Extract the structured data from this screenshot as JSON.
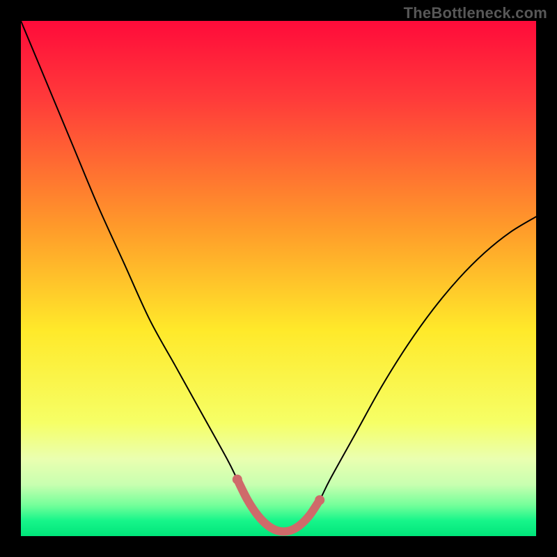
{
  "watermark": "TheBottleneck.com",
  "chart_data": {
    "type": "line",
    "title": "",
    "xlabel": "",
    "ylabel": "",
    "xlim": [
      0,
      100
    ],
    "ylim": [
      0,
      100
    ],
    "x": [
      0,
      5,
      10,
      15,
      20,
      25,
      30,
      35,
      40,
      42,
      44,
      46,
      48,
      50,
      52,
      54,
      56,
      58,
      60,
      65,
      70,
      75,
      80,
      85,
      90,
      95,
      100
    ],
    "y": [
      100,
      88,
      76,
      64,
      53,
      42,
      33,
      24,
      15,
      11,
      7,
      4,
      2,
      1,
      1,
      2,
      4,
      7,
      11,
      20,
      29,
      37,
      44,
      50,
      55,
      59,
      62
    ],
    "series": [
      {
        "name": "bottleneck-curve",
        "stroke": "#000000",
        "stroke_width": 2
      },
      {
        "name": "sweet-spot-highlight",
        "stroke": "#cf6a6a",
        "stroke_width": 12,
        "x": [
          42,
          44,
          46,
          48,
          50,
          52,
          54,
          56,
          58
        ],
        "y": [
          11,
          7,
          4,
          2,
          1,
          1,
          2,
          4,
          7
        ]
      }
    ],
    "background_gradient_stops": [
      {
        "offset": 0.0,
        "color": "#ff0b3a"
      },
      {
        "offset": 0.15,
        "color": "#ff3a3a"
      },
      {
        "offset": 0.4,
        "color": "#ff9a2a"
      },
      {
        "offset": 0.6,
        "color": "#ffe92a"
      },
      {
        "offset": 0.78,
        "color": "#f6ff66"
      },
      {
        "offset": 0.85,
        "color": "#eaffb0"
      },
      {
        "offset": 0.9,
        "color": "#c8ffb0"
      },
      {
        "offset": 0.94,
        "color": "#74ff9a"
      },
      {
        "offset": 0.97,
        "color": "#17f58a"
      },
      {
        "offset": 1.0,
        "color": "#00e57a"
      }
    ]
  }
}
